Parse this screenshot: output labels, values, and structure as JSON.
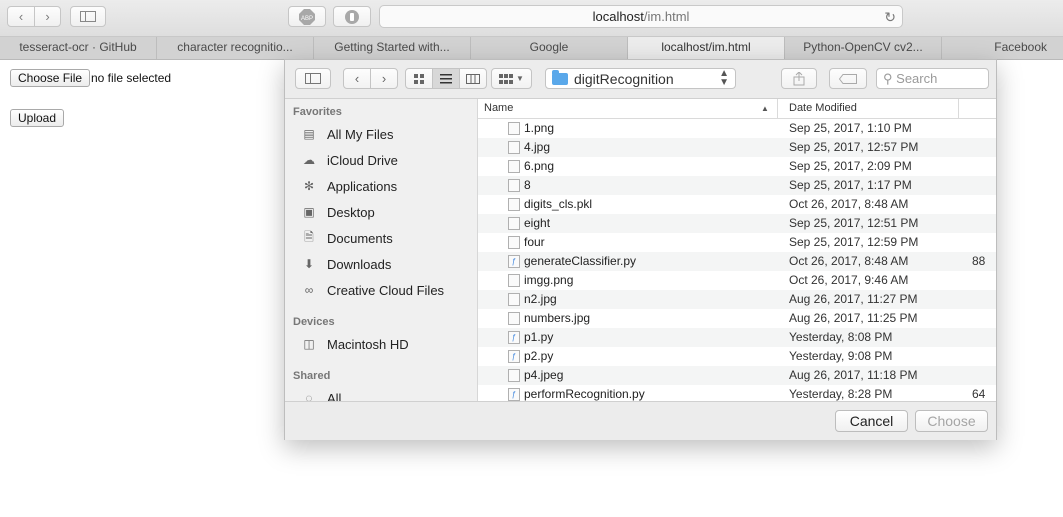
{
  "browser": {
    "url_host": "localhost",
    "url_path": "/im.html",
    "tabs": [
      {
        "label": "tesseract-ocr · GitHub"
      },
      {
        "label": "character recognitio..."
      },
      {
        "label": "Getting Started with..."
      },
      {
        "label": "Google"
      },
      {
        "label": "localhost/im.html"
      },
      {
        "label": "Python-OpenCV cv2..."
      },
      {
        "label": "Facebook"
      }
    ]
  },
  "page": {
    "choose_file_label": "Choose File",
    "file_status": "no file selected",
    "upload_label": "Upload"
  },
  "dialog": {
    "location": "digitRecognition",
    "search_placeholder": "Search",
    "sidebar": {
      "favorites_heading": "Favorites",
      "favorites": [
        {
          "label": "All My Files",
          "icon": "all-files-icon"
        },
        {
          "label": "iCloud Drive",
          "icon": "cloud-icon"
        },
        {
          "label": "Applications",
          "icon": "applications-icon"
        },
        {
          "label": "Desktop",
          "icon": "desktop-icon"
        },
        {
          "label": "Documents",
          "icon": "documents-icon"
        },
        {
          "label": "Downloads",
          "icon": "downloads-icon"
        },
        {
          "label": "Creative Cloud Files",
          "icon": "creative-cloud-icon"
        }
      ],
      "devices_heading": "Devices",
      "devices": [
        {
          "label": "Macintosh HD",
          "icon": "disk-icon"
        }
      ],
      "shared_heading": "Shared",
      "shared": [
        {
          "label": "All",
          "icon": "network-icon"
        }
      ]
    },
    "columns": {
      "name": "Name",
      "date": "Date Modified"
    },
    "files": [
      {
        "name": "1.png",
        "date": "Sep 25, 2017, 1:10 PM",
        "extra": ""
      },
      {
        "name": "4.jpg",
        "date": "Sep 25, 2017, 12:57 PM",
        "extra": ""
      },
      {
        "name": "6.png",
        "date": "Sep 25, 2017, 2:09 PM",
        "extra": ""
      },
      {
        "name": "8",
        "date": "Sep 25, 2017, 1:17 PM",
        "extra": ""
      },
      {
        "name": "digits_cls.pkl",
        "date": "Oct 26, 2017, 8:48 AM",
        "extra": ""
      },
      {
        "name": "eight",
        "date": "Sep 25, 2017, 12:51 PM",
        "extra": ""
      },
      {
        "name": "four",
        "date": "Sep 25, 2017, 12:59 PM",
        "extra": ""
      },
      {
        "name": "generateClassifier.py",
        "date": "Oct 26, 2017, 8:48 AM",
        "extra": "88"
      },
      {
        "name": "imgg.png",
        "date": "Oct 26, 2017, 9:46 AM",
        "extra": ""
      },
      {
        "name": "n2.jpg",
        "date": "Aug 26, 2017, 11:27 PM",
        "extra": ""
      },
      {
        "name": "numbers.jpg",
        "date": "Aug 26, 2017, 11:25 PM",
        "extra": ""
      },
      {
        "name": "p1.py",
        "date": "Yesterday, 8:08 PM",
        "extra": ""
      },
      {
        "name": "p2.py",
        "date": "Yesterday, 9:08 PM",
        "extra": ""
      },
      {
        "name": "p4.jpeg",
        "date": "Aug 26, 2017, 11:18 PM",
        "extra": ""
      },
      {
        "name": "performRecognition.py",
        "date": "Yesterday, 8:28 PM",
        "extra": "64"
      }
    ],
    "cancel_label": "Cancel",
    "choose_label": "Choose"
  }
}
